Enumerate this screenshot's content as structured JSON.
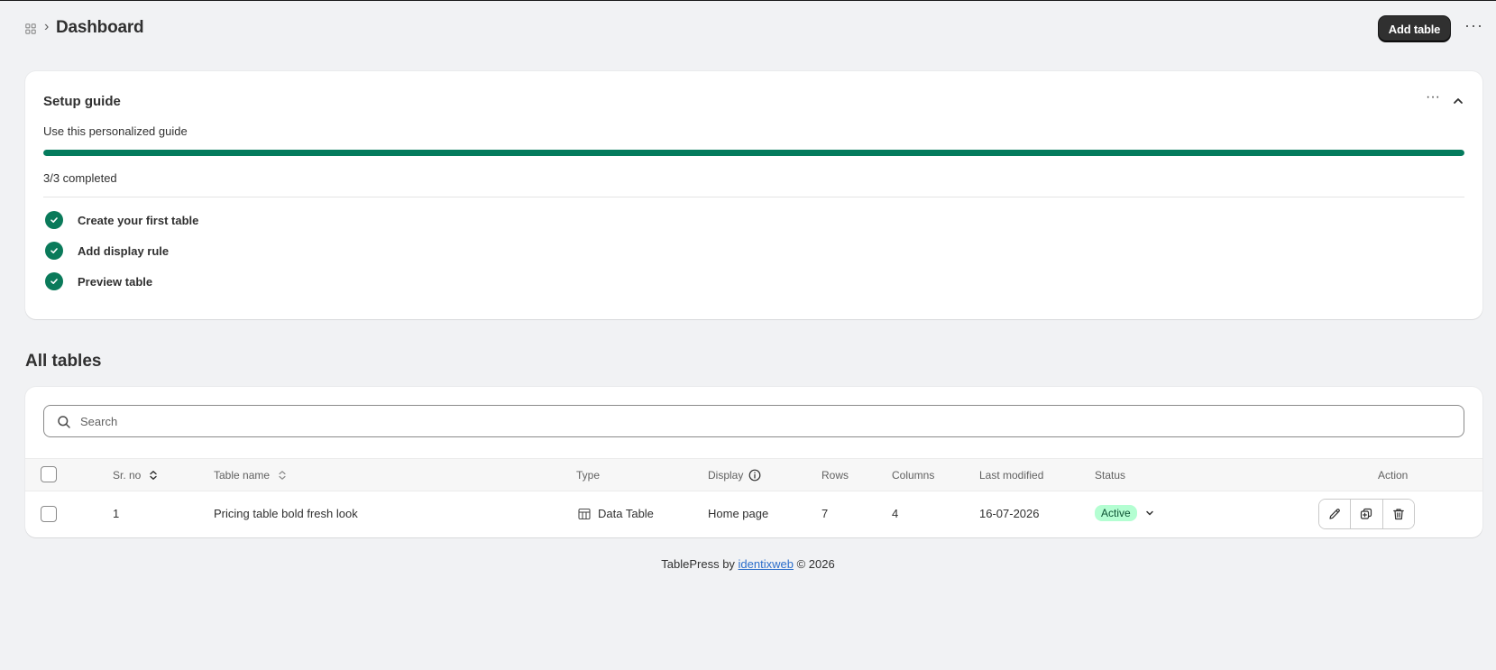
{
  "header": {
    "breadcrumb_icon": "apps-icon",
    "separator": "›",
    "title": "Dashboard",
    "add_button": "Add table",
    "more": "···"
  },
  "setup_guide": {
    "title": "Setup guide",
    "subtitle": "Use this personalized guide",
    "progress": 1.0,
    "progress_text": "3/3 completed",
    "more": "···",
    "steps": [
      {
        "label": "Create your first table",
        "done": true
      },
      {
        "label": "Add display rule",
        "done": true
      },
      {
        "label": "Preview table",
        "done": true
      }
    ]
  },
  "tables_section": {
    "title": "All tables",
    "search_placeholder": "Search",
    "columns": {
      "sr_no": "Sr. no",
      "table_name": "Table name",
      "type": "Type",
      "display": "Display",
      "rows": "Rows",
      "columns": "Columns",
      "last_modified": "Last modified",
      "status": "Status",
      "action": "Action"
    },
    "rows": [
      {
        "sr_no": "1",
        "table_name": "Pricing table bold fresh look",
        "type": "Data Table",
        "display": "Home page",
        "rows": "7",
        "columns": "4",
        "last_modified": "16-07-2026",
        "status": "Active"
      }
    ]
  },
  "footer": {
    "prefix": "TablePress by ",
    "link": "identixweb",
    "suffix": " © 2026"
  },
  "colors": {
    "accent_green": "#047b5d",
    "badge_bg": "#b4fed2",
    "primary_button": "#303030",
    "link": "#2c6ecb"
  }
}
